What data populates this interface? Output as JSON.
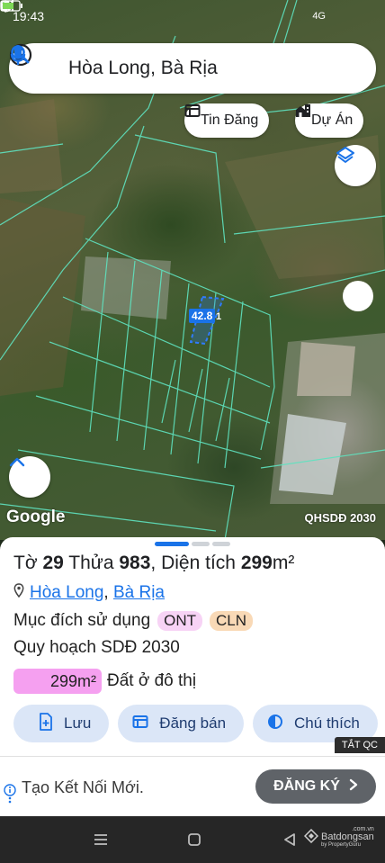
{
  "status_bar": {
    "time": "19:43",
    "network": "4G"
  },
  "search": {
    "query": "Hòa Long, Bà Rịa"
  },
  "chips": {
    "listings": "Tin Đăng",
    "projects": "Dự Án"
  },
  "map": {
    "measure_label": "42.8",
    "measure_suffix": "1",
    "google_label": "Google",
    "layer_label": "QHSDĐ 2030"
  },
  "parcel": {
    "sheet_prefix": "Tờ",
    "sheet_no": "29",
    "lot_prefix": "Thửa",
    "lot_no": "983",
    "area_prefix": ", Diện tích",
    "area_value": "299",
    "area_unit": "m²",
    "ward": "Hòa Long",
    "separator": ",",
    "city": "Bà Rịa",
    "usage_label": "Mục đích sử dụng",
    "usage_codes": [
      {
        "code": "ONT",
        "bg": "#f7d3f5"
      },
      {
        "code": "CLN",
        "bg": "#f9d9b6"
      }
    ],
    "plan_label": "Quy hoạch SDĐ 2030",
    "plan_area": "299m²",
    "plan_area_fill": 1.0,
    "plan_area_color": "#f5a0f0",
    "plan_type": "Đất ở đô thị"
  },
  "actions": {
    "save": "Lưu",
    "post_sale": "Đăng bán",
    "legend": "Chú thích"
  },
  "ad": {
    "close_label": "TẮT QC",
    "text": "Tạo Kết Nối Mới.",
    "cta": "ĐĂNG KÝ"
  },
  "watermark": {
    "brand": "Batdongsan",
    "sub": "by PropertyGuru",
    "domain": ".com.vn"
  },
  "colors": {
    "accent": "#1a73e8",
    "parcel_lines": "#5fe3c0",
    "button_bg": "#dbe6f7"
  }
}
